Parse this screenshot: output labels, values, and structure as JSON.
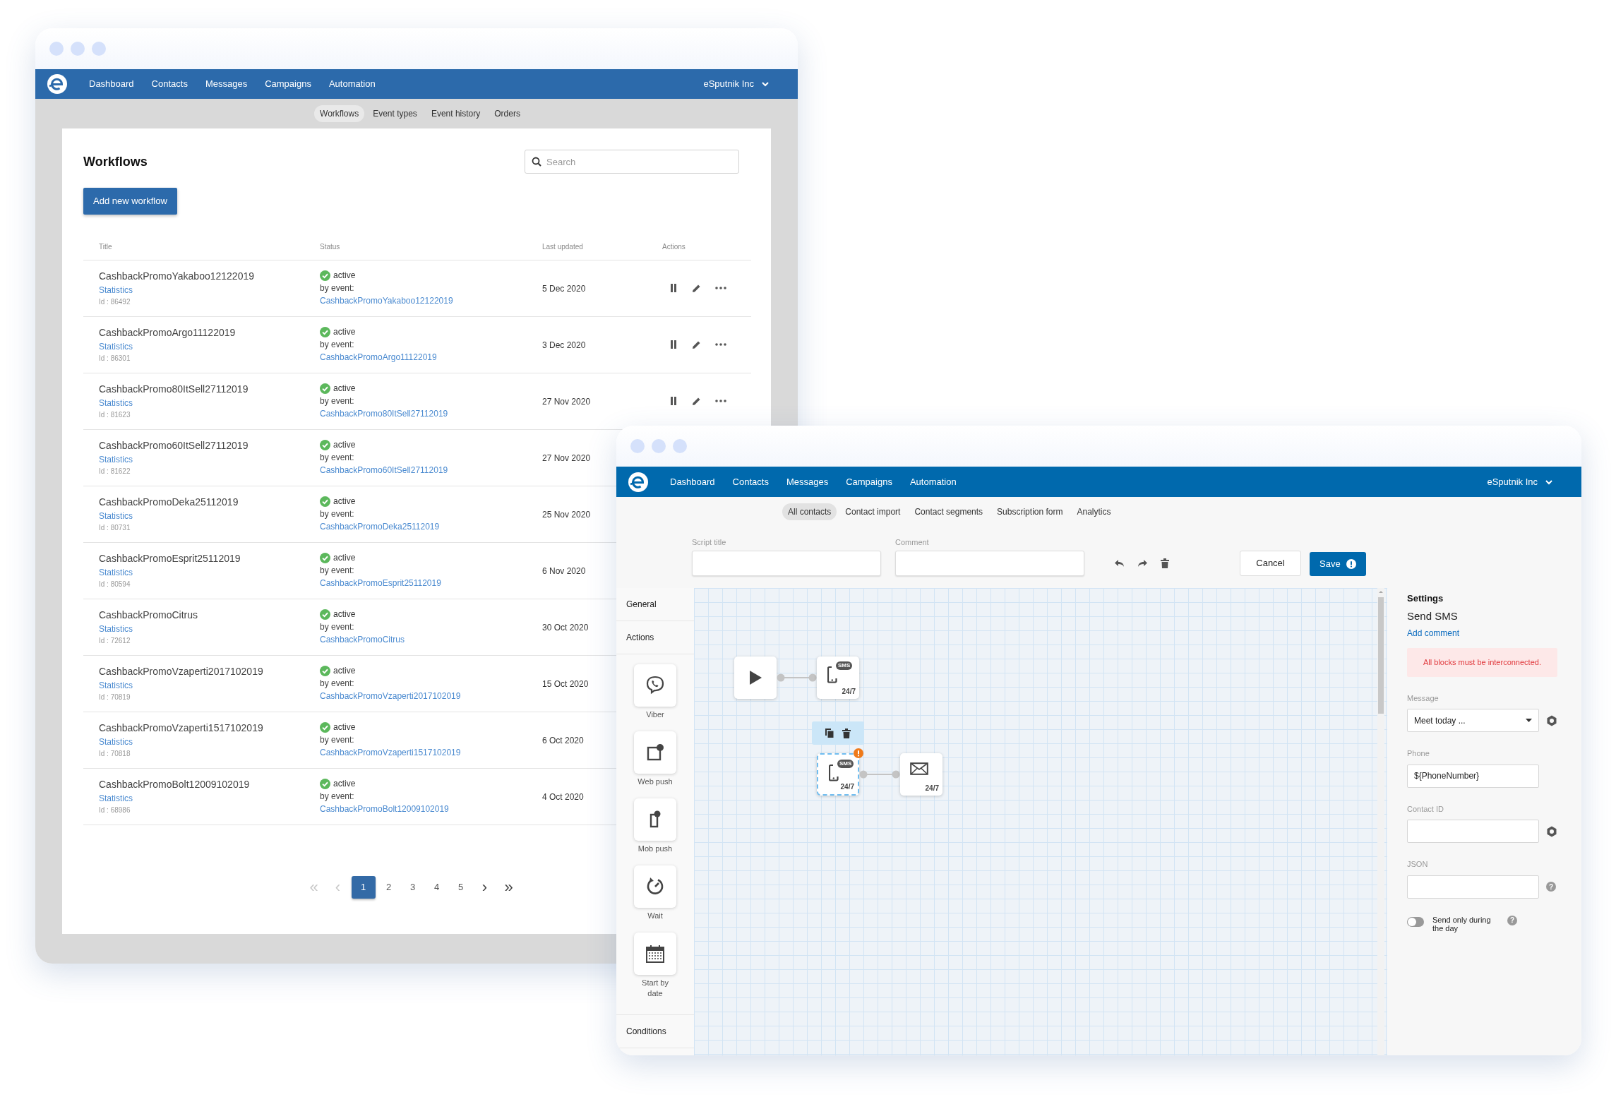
{
  "back_window": {
    "nav": {
      "items": [
        "Dashboard",
        "Contacts",
        "Messages",
        "Campaigns",
        "Automation"
      ],
      "account": "eSputnik Inc"
    },
    "subnav": [
      {
        "label": "Workflows",
        "selected": true
      },
      {
        "label": "Event types",
        "selected": false
      },
      {
        "label": "Event history",
        "selected": false
      },
      {
        "label": "Orders",
        "selected": false
      }
    ],
    "title": "Workflows",
    "search": {
      "placeholder": "Search"
    },
    "add_button": "Add new workflow",
    "table": {
      "columns": [
        "Title",
        "Status",
        "Last updated",
        "Actions"
      ],
      "rows": [
        {
          "title": "CashbackPromoYakaboo12122019",
          "link": "Statistics",
          "id": "Id : 86492",
          "status": "active",
          "trigger": "by event:",
          "event": "CashbackPromoYakaboo12122019",
          "updated": "5 Dec 2020",
          "actions_visible": true
        },
        {
          "title": "CashbackPromoArgo11122019",
          "link": "Statistics",
          "id": "Id : 86301",
          "status": "active",
          "trigger": "by event:",
          "event": "CashbackPromoArgo11122019",
          "updated": "3 Dec 2020",
          "actions_visible": true
        },
        {
          "title": "CashbackPromo80ItSell27112019",
          "link": "Statistics",
          "id": "Id : 81623",
          "status": "active",
          "trigger": "by event:",
          "event": "CashbackPromo80ItSell27112019",
          "updated": "27 Nov 2020",
          "actions_visible": true
        },
        {
          "title": "CashbackPromo60ItSell27112019",
          "link": "Statistics",
          "id": "Id : 81622",
          "status": "active",
          "trigger": "by event:",
          "event": "CashbackPromo60ItSell27112019",
          "updated": "27 Nov 2020"
        },
        {
          "title": "CashbackPromoDeka25112019",
          "link": "Statistics",
          "id": "Id : 80731",
          "status": "active",
          "trigger": "by event:",
          "event": "CashbackPromoDeka25112019",
          "updated": "25 Nov 2020"
        },
        {
          "title": "CashbackPromoEsprit25112019",
          "link": "Statistics",
          "id": "Id : 80594",
          "status": "active",
          "trigger": "by event:",
          "event": "CashbackPromoEsprit25112019",
          "updated": "6 Nov 2020"
        },
        {
          "title": "CashbackPromoCitrus",
          "link": "Statistics",
          "id": "Id : 72612",
          "status": "active",
          "trigger": "by event:",
          "event": "CashbackPromoCitrus",
          "updated": "30 Oct 2020"
        },
        {
          "title": "CashbackPromoVzaperti2017102019",
          "link": "Statistics",
          "id": "Id : 70819",
          "status": "active",
          "trigger": "by event:",
          "event": "CashbackPromoVzaperti2017102019",
          "updated": "15 Oct 2020"
        },
        {
          "title": "CashbackPromoVzaperti1517102019",
          "link": "Statistics",
          "id": "Id : 70818",
          "status": "active",
          "trigger": "by event:",
          "event": "CashbackPromoVzaperti1517102019",
          "updated": "6 Oct 2020"
        },
        {
          "title": "CashbackPromoBolt12009102019",
          "link": "Statistics",
          "id": "Id : 68986",
          "status": "active",
          "trigger": "by event:",
          "event": "CashbackPromoBolt12009102019",
          "updated": "4 Oct 2020"
        }
      ]
    },
    "pagination": [
      {
        "kind": "arrow",
        "label": "«",
        "disabled": true,
        "selected": false
      },
      {
        "kind": "arrow",
        "label": "‹",
        "disabled": true,
        "selected": false
      },
      {
        "kind": "page",
        "label": "1",
        "disabled": false,
        "selected": true
      },
      {
        "kind": "page",
        "label": "2",
        "disabled": false,
        "selected": false
      },
      {
        "kind": "page",
        "label": "3",
        "disabled": false,
        "selected": false
      },
      {
        "kind": "page",
        "label": "4",
        "disabled": false,
        "selected": false
      },
      {
        "kind": "page",
        "label": "5",
        "disabled": false,
        "selected": false
      },
      {
        "kind": "arrow",
        "label": "›",
        "disabled": false,
        "selected": false
      },
      {
        "kind": "arrow",
        "label": "»",
        "disabled": false,
        "selected": false
      }
    ]
  },
  "front_window": {
    "nav": {
      "items": [
        "Dashboard",
        "Contacts",
        "Messages",
        "Campaigns",
        "Automation"
      ],
      "account": "eSputnik Inc"
    },
    "subnav": [
      {
        "label": "All contacts",
        "selected": true
      },
      {
        "label": "Contact import",
        "selected": false
      },
      {
        "label": "Contact segments",
        "selected": false
      },
      {
        "label": "Subscription form",
        "selected": false
      },
      {
        "label": "Analytics",
        "selected": false
      }
    ],
    "fields": [
      {
        "label": "Script title"
      },
      {
        "label": "Comment"
      }
    ],
    "cancel_button": "Cancel",
    "save_button": {
      "label": "Save",
      "warning": true
    },
    "sidebar": [
      {
        "title": "General"
      },
      {
        "title": "Actions",
        "tiles": [
          {
            "kind": "viber",
            "label": "Viber"
          },
          {
            "kind": "webpush",
            "label": "Web push"
          },
          {
            "kind": "mobpush",
            "label": "Mob push"
          },
          {
            "kind": "wait",
            "label": "Wait"
          },
          {
            "kind": "date",
            "label": "Start by date"
          }
        ]
      },
      {
        "title": "Conditions"
      }
    ],
    "canvas": {
      "nodes": [
        {
          "kind": "start",
          "selected": false,
          "warning": false,
          "connected_to_next": true
        },
        {
          "kind": "sms",
          "bubble": "SMS",
          "schedule": "24/7",
          "selected": false,
          "warning": false,
          "connected_to_next": false
        },
        {
          "kind": "sms",
          "bubble": "SMS",
          "schedule": "24/7",
          "selected": true,
          "warning": true,
          "connected_to_next": true
        },
        {
          "kind": "email",
          "schedule": "24/7",
          "selected": false,
          "warning": false
        }
      ]
    },
    "settings": {
      "title": "Settings",
      "subtitle": "Send SMS",
      "add_comment": "Add comment",
      "error": "All blocks must be interconnected.",
      "fields": [
        {
          "kind": "select",
          "label": "Message",
          "value": "Meet today ...",
          "addon": {
            "kind": "gear"
          }
        },
        {
          "kind": "text",
          "label": "Phone",
          "value": "${PhoneNumber}"
        },
        {
          "kind": "text",
          "label": "Contact ID",
          "addon": {
            "kind": "gear"
          }
        },
        {
          "kind": "text",
          "label": "JSON",
          "addon": {
            "kind": "help",
            "label": "?"
          }
        }
      ],
      "toggle": {
        "label": "Send only during the day",
        "on": false,
        "help": "?"
      }
    }
  }
}
